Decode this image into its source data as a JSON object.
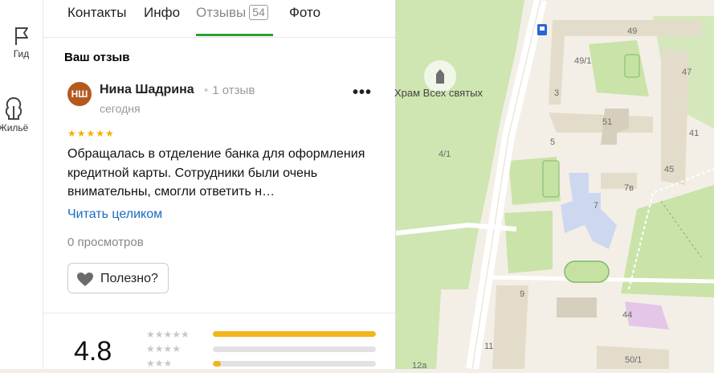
{
  "rail": {
    "items": [
      {
        "label": "Гид",
        "icon": "flag-icon"
      },
      {
        "label": "Жильё",
        "icon": "house-icon"
      }
    ]
  },
  "tabs": {
    "contacts": "Контакты",
    "info": "Инфо",
    "reviews": "Отзывы",
    "reviews_count": "54",
    "photo": "Фото"
  },
  "review": {
    "section_title": "Ваш отзыв",
    "avatar_initials": "НШ",
    "author": "Нина Шадрина",
    "author_reviews": "1 отзыв",
    "date": "сегодня",
    "stars": "★★★★★",
    "rating": 5,
    "text": "Обращалась в отделение банка для оформления кредитной карты. Сотрудники были очень внимательны, смогли ответить н…",
    "read_more": "Читать целиком",
    "views": "0 просмотров",
    "helpful": "Полезно?"
  },
  "summary": {
    "rating": "4.8",
    "histogram": [
      {
        "stars": "★★★★★",
        "fraction": 1.0
      },
      {
        "stars": "★★★★",
        "fraction": 0.0
      },
      {
        "stars": "★★★",
        "fraction": 0.05
      }
    ]
  },
  "map": {
    "poi_label": "Храм Всех святых",
    "house_numbers": [
      "49",
      "49/1",
      "47",
      "3",
      "51",
      "41",
      "5",
      "4/1",
      "45",
      "7в",
      "7",
      "9",
      "44",
      "11",
      "50/1",
      "12а"
    ],
    "colors": {
      "green": "#c9e3a9",
      "building": "#e4dccb",
      "road": "#ffffff",
      "school": "#cdd8f0"
    }
  }
}
